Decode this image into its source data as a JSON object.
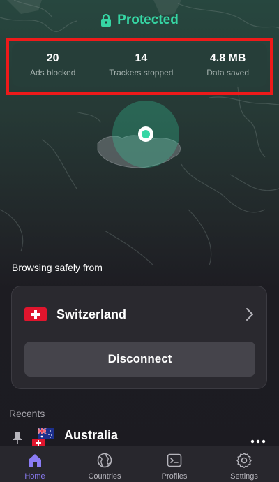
{
  "status": {
    "label": "Protected",
    "color": "#36d6a4"
  },
  "stats": [
    {
      "value": "20",
      "label": "Ads blocked"
    },
    {
      "value": "14",
      "label": "Trackers stopped"
    },
    {
      "value": "4.8 MB",
      "label": "Data saved"
    }
  ],
  "connection": {
    "heading": "Browsing safely from",
    "country": "Switzerland",
    "disconnect_label": "Disconnect"
  },
  "recents": {
    "heading": "Recents",
    "items": [
      {
        "country": "Australia"
      }
    ]
  },
  "tabs": [
    {
      "label": "Home",
      "icon": "home-icon",
      "active": true
    },
    {
      "label": "Countries",
      "icon": "globe-icon",
      "active": false
    },
    {
      "label": "Profiles",
      "icon": "terminal-icon",
      "active": false
    },
    {
      "label": "Settings",
      "icon": "gear-icon",
      "active": false
    }
  ],
  "colors": {
    "accent": "#8b7cf5",
    "map_pin": "#36d6a4",
    "swiss_red": "#e0152d"
  }
}
